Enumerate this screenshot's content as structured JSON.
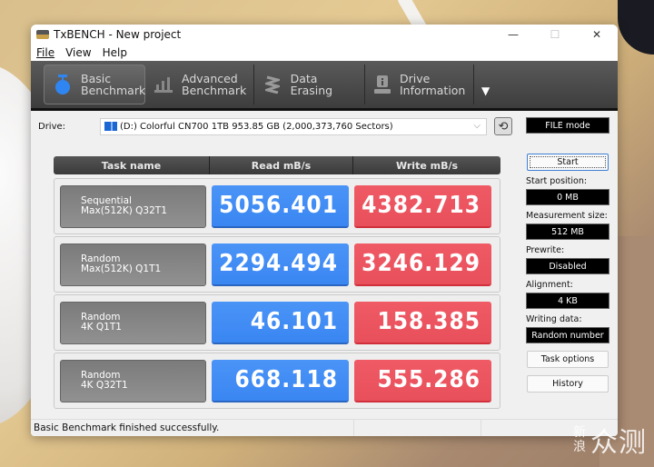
{
  "window": {
    "title": "TxBENCH - New project",
    "controls": {
      "minimize": "—",
      "maximize": "☐",
      "close": "✕"
    }
  },
  "menu": [
    "File",
    "View",
    "Help"
  ],
  "toolbar": {
    "tabs": [
      {
        "line1": "Basic",
        "line2": "Benchmark",
        "icon": "stopwatch-icon",
        "active": true
      },
      {
        "line1": "Advanced",
        "line2": "Benchmark",
        "icon": "bar-chart-icon",
        "active": false
      },
      {
        "line1": "Data Erasing",
        "line2": "",
        "icon": "spring-icon",
        "active": false
      },
      {
        "line1": "Drive",
        "line2": "Information",
        "icon": "drive-info-icon",
        "active": false
      }
    ],
    "more_arrow": "▼"
  },
  "drive": {
    "label": "Drive:",
    "selected": "(D:) Colorful CN700 1TB  953.85 GB (2,000,373,760 Sectors)",
    "chevron": "⌵",
    "refresh_glyph": "⟲"
  },
  "table": {
    "headers": [
      "Task name",
      "Read mB/s",
      "Write mB/s"
    ],
    "rows": [
      {
        "name1": "Sequential",
        "name2": "Max(512K) Q32T1",
        "read": "5056.401",
        "write": "4382.713"
      },
      {
        "name1": "Random",
        "name2": "Max(512K) Q1T1",
        "read": "2294.494",
        "write": "3246.129"
      },
      {
        "name1": "Random",
        "name2": "4K Q1T1",
        "read": "46.101",
        "write": "158.385"
      },
      {
        "name1": "Random",
        "name2": "4K Q32T1",
        "read": "668.118",
        "write": "555.286"
      }
    ]
  },
  "side": {
    "mode": "FILE mode",
    "start_button": "Start",
    "start_position_label": "Start position:",
    "start_position": "0 MB",
    "measurement_size_label": "Measurement size:",
    "measurement_size": "512 MB",
    "prewrite_label": "Prewrite:",
    "prewrite": "Disabled",
    "alignment_label": "Alignment:",
    "alignment": "4 KB",
    "writing_data_label": "Writing data:",
    "writing_data": "Random number",
    "task_options_button": "Task options",
    "history_button": "History"
  },
  "status": {
    "message": "Basic Benchmark finished successfully."
  },
  "colors": {
    "read": "#3f8cf5",
    "write": "#ec5560",
    "toolbar": "#4a4a4a",
    "accent_icon": "#2f86f2"
  },
  "watermark": {
    "small1": "新",
    "small2": "浪",
    "big": "众测"
  }
}
